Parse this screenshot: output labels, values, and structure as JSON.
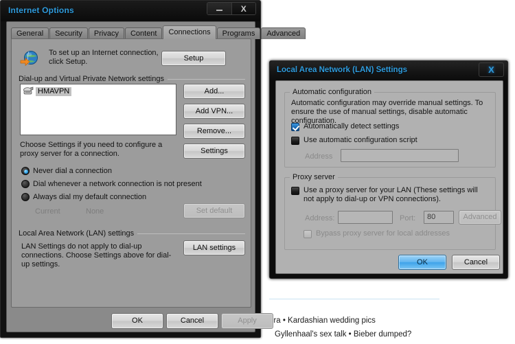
{
  "background_page": {
    "line1": "ora  •  Kardashian wedding pics",
    "line2": "Gyllenhaal's sex talk  •  Bieber dumped?"
  },
  "internet_options": {
    "title": "Internet Options",
    "minimize_label": "Minimize",
    "close_label": "X",
    "tabs": [
      {
        "label": "General",
        "active": false
      },
      {
        "label": "Security",
        "active": false
      },
      {
        "label": "Privacy",
        "active": false
      },
      {
        "label": "Content",
        "active": false
      },
      {
        "label": "Connections",
        "active": true
      },
      {
        "label": "Programs",
        "active": false
      },
      {
        "label": "Advanced",
        "active": false
      }
    ],
    "setup": {
      "description": "To set up an Internet connection, click Setup.",
      "button_label": "Setup"
    },
    "dialup_group": {
      "label": "Dial-up and Virtual Private Network settings",
      "connections": [
        "HMAVPN"
      ],
      "buttons": {
        "add": "Add...",
        "add_vpn": "Add VPN...",
        "remove": "Remove...",
        "settings": "Settings"
      },
      "hint": "Choose Settings if you need to configure a proxy server for a connection.",
      "radios": [
        {
          "label": "Never dial a connection",
          "checked": true
        },
        {
          "label": "Dial whenever a network connection is not present",
          "checked": false
        },
        {
          "label": "Always dial my default connection",
          "checked": false
        }
      ],
      "current_label": "Current",
      "current_value": "None",
      "set_default_label": "Set default"
    },
    "lan_group": {
      "label": "Local Area Network (LAN) settings",
      "description": "LAN Settings do not apply to dial-up connections. Choose Settings above for dial-up settings.",
      "button_label": "LAN settings"
    },
    "footer": {
      "ok": "OK",
      "cancel": "Cancel",
      "apply": "Apply"
    }
  },
  "lan_settings": {
    "title": "Local Area Network (LAN) Settings",
    "close_label": "X",
    "automatic_configuration": {
      "group_label": "Automatic configuration",
      "description": "Automatic configuration may override manual settings.  To ensure the use of manual settings, disable automatic configuration.",
      "auto_detect": {
        "label": "Automatically detect settings",
        "checked": true
      },
      "use_script": {
        "label": "Use automatic configuration script",
        "checked": false
      },
      "address_label": "Address",
      "address_value": ""
    },
    "proxy_server": {
      "group_label": "Proxy server",
      "use_proxy": {
        "label": "Use a proxy server for your LAN (These settings will not apply to dial-up or VPN connections).",
        "checked": false
      },
      "address_label": "Address:",
      "address_value": "",
      "port_label": "Port:",
      "port_value": "80",
      "advanced_label": "Advanced",
      "bypass": {
        "label": "Bypass proxy server for local addresses",
        "checked": false
      }
    },
    "footer": {
      "ok": "OK",
      "cancel": "Cancel"
    }
  }
}
